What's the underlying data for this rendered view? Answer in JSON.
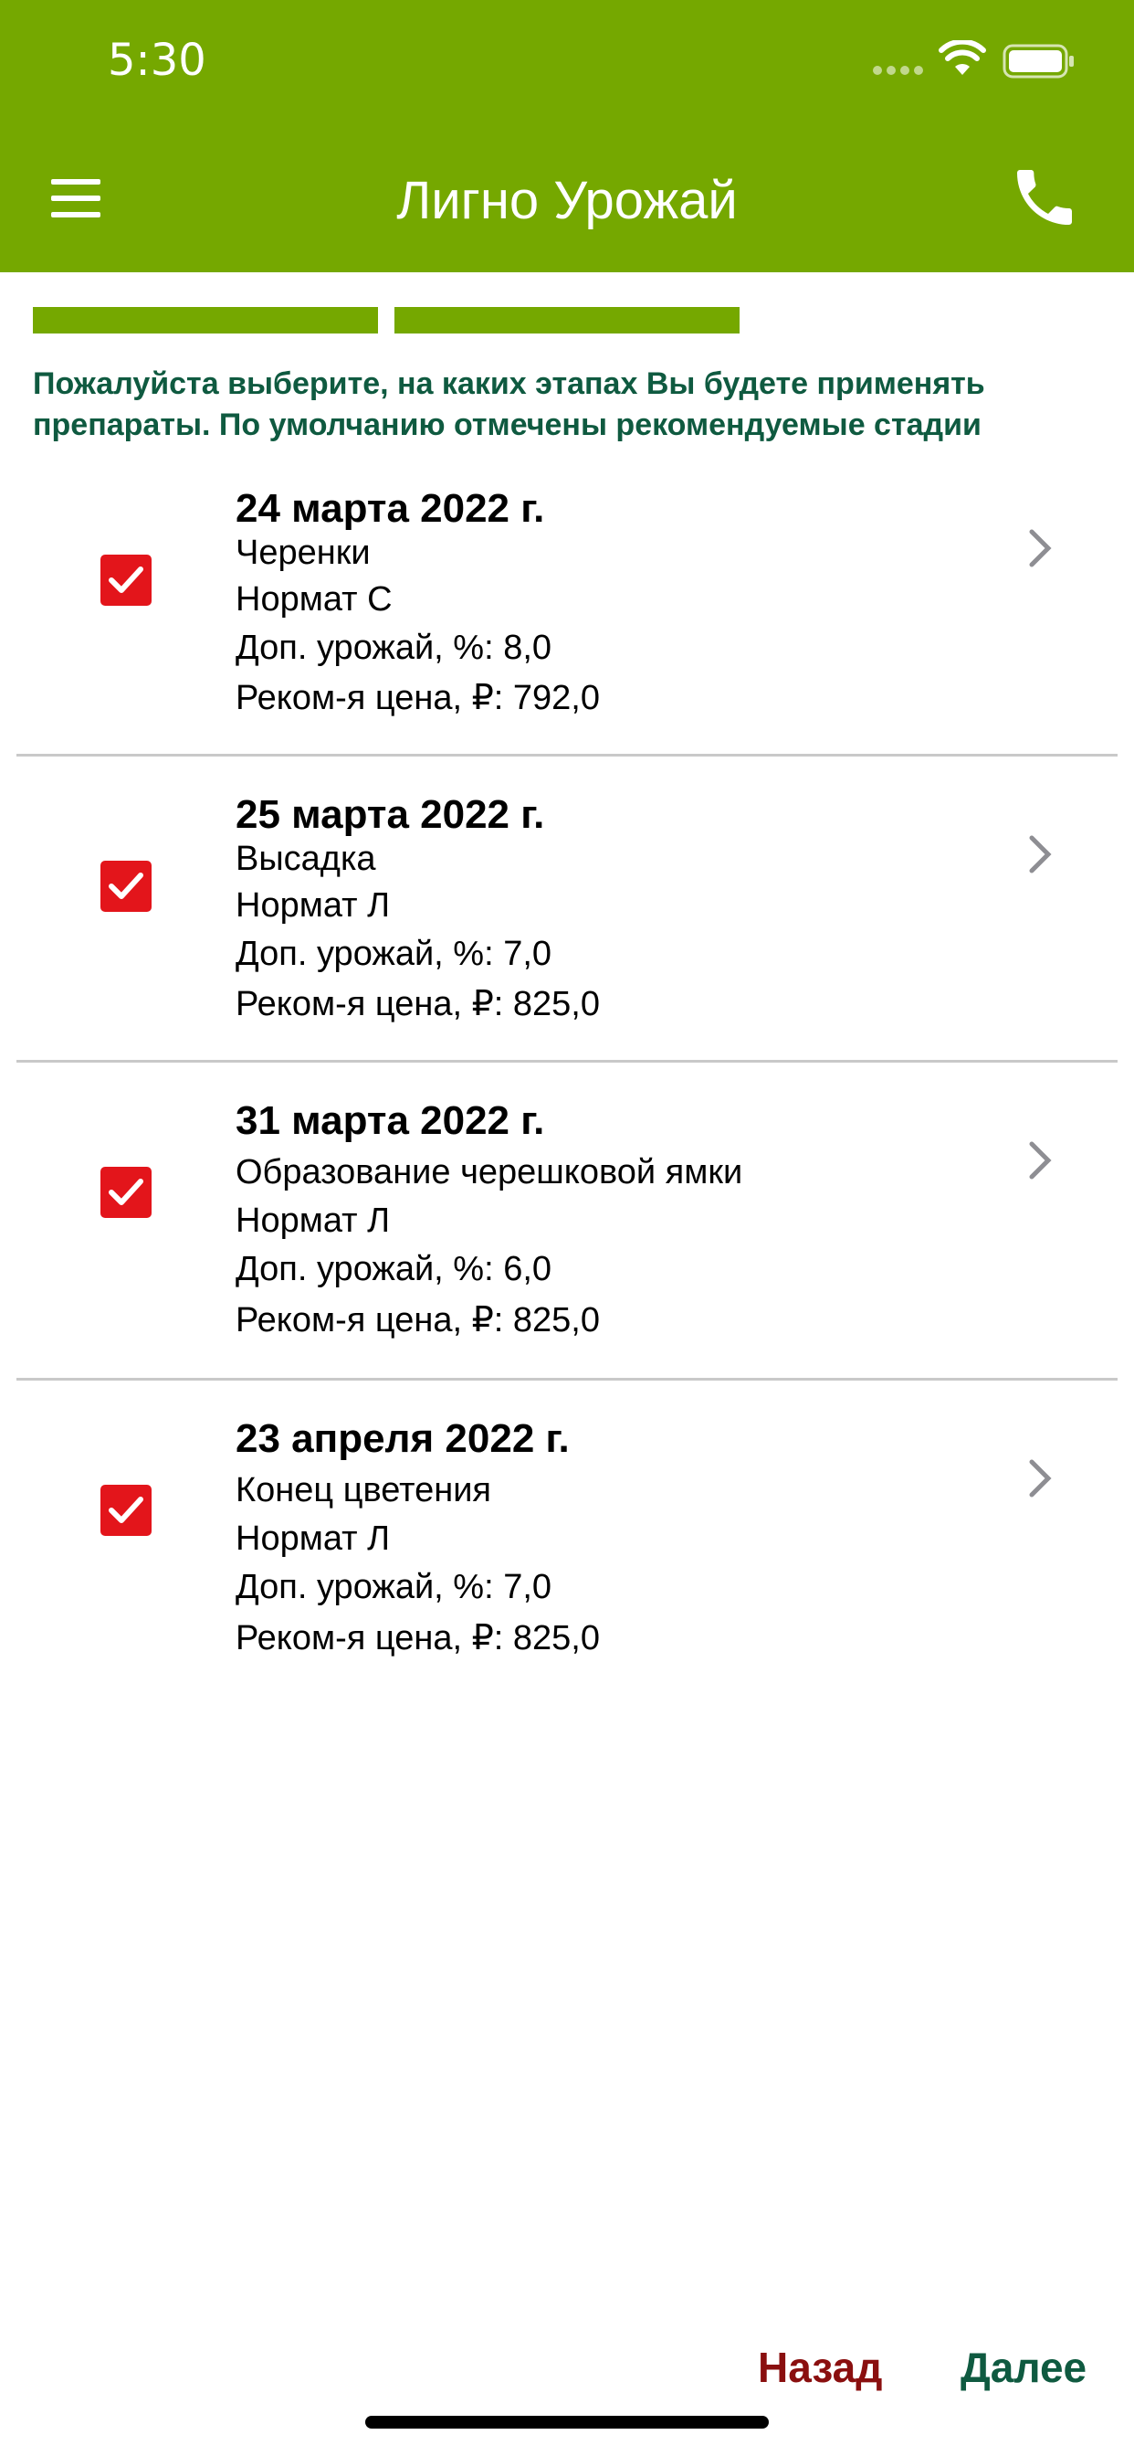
{
  "status_bar": {
    "time": "5:30"
  },
  "header": {
    "title": "Лигно Урожай"
  },
  "progress": {
    "steps_completed": 2
  },
  "instructions": "Пожалуйста выберите, на каких этапах Вы будете применять препараты. По умолчанию отмечены рекомендуемые стадии",
  "items": [
    {
      "date": "24 марта 2022 г.",
      "stage": "Черенки",
      "product": "Нормат С",
      "yield": "Доп. урожай, %: 8,0",
      "price": "Реком-я цена, ₽: 792,0",
      "checked": true
    },
    {
      "date": "25 марта 2022 г.",
      "stage": "Высадка",
      "product": "Нормат Л",
      "yield": "Доп. урожай, %: 7,0",
      "price": "Реком-я цена, ₽: 825,0",
      "checked": true
    },
    {
      "date": "31 марта 2022 г.",
      "stage": "Образование черешковой ямки",
      "product": "Нормат Л",
      "yield": "Доп. урожай, %: 6,0",
      "price": "Реком-я цена, ₽: 825,0",
      "checked": true
    },
    {
      "date": "23 апреля 2022 г.",
      "stage": "Конец цветения",
      "product": "Нормат Л",
      "yield": "Доп. урожай, %: 7,0",
      "price": "Реком-я цена, ₽: 825,0",
      "checked": true
    }
  ],
  "footer": {
    "back": "Назад",
    "next": "Далее"
  },
  "colors": {
    "header": "#75a800",
    "accent_text": "#0f5a40",
    "checkbox": "#e3151b",
    "back": "#8a0f0f"
  }
}
